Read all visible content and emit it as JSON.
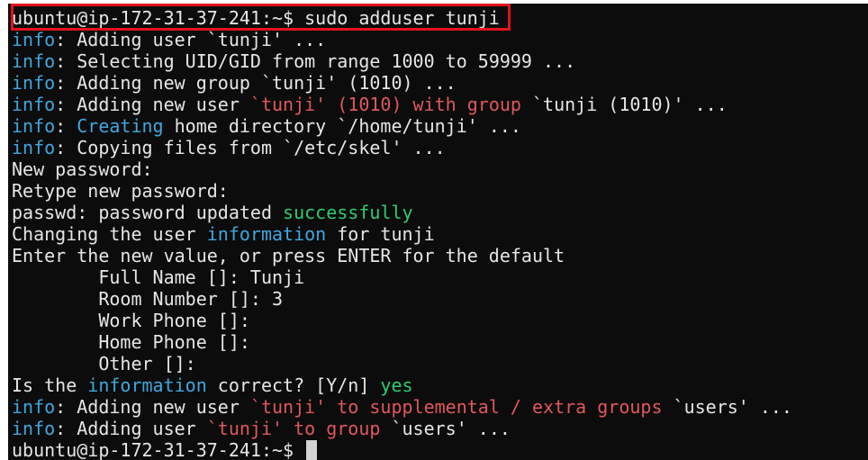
{
  "terminal": {
    "highlight_color": "#e3131b",
    "colors": {
      "default": "#e6e6e6",
      "info": "#3fa7df",
      "highlight_red": "#e0575d",
      "success_green": "#2ecc71",
      "background": "#0c0c0c"
    },
    "lines": [
      [
        {
          "t": "ubuntu@ip-172-31-37-241:~$ sudo adduser tunji",
          "c": ""
        }
      ],
      [
        {
          "t": "info",
          "c": "cyan"
        },
        {
          "t": ": Adding user `tunji' ...",
          "c": ""
        }
      ],
      [
        {
          "t": "info",
          "c": "cyan"
        },
        {
          "t": ": Selecting UID/GID from range 1000 to 59999 ...",
          "c": ""
        }
      ],
      [
        {
          "t": "info",
          "c": "cyan"
        },
        {
          "t": ": Adding new group `tunji' (1010) ...",
          "c": ""
        }
      ],
      [
        {
          "t": "info",
          "c": "cyan"
        },
        {
          "t": ": Adding new user ",
          "c": ""
        },
        {
          "t": "`tunji' (1010) with group",
          "c": "red"
        },
        {
          "t": " `tunji (1010)' ...",
          "c": ""
        }
      ],
      [
        {
          "t": "info",
          "c": "cyan"
        },
        {
          "t": ": ",
          "c": ""
        },
        {
          "t": "Creating",
          "c": "cyan"
        },
        {
          "t": " home directory `/home/tunji' ...",
          "c": ""
        }
      ],
      [
        {
          "t": "info",
          "c": "cyan"
        },
        {
          "t": ": Copying files from `/etc/skel' ...",
          "c": ""
        }
      ],
      [
        {
          "t": "New password:",
          "c": ""
        }
      ],
      [
        {
          "t": "Retype new password:",
          "c": ""
        }
      ],
      [
        {
          "t": "passwd: password updated ",
          "c": ""
        },
        {
          "t": "successfully",
          "c": "green"
        }
      ],
      [
        {
          "t": "Changing the user ",
          "c": ""
        },
        {
          "t": "information",
          "c": "cyan"
        },
        {
          "t": " for tunji",
          "c": ""
        }
      ],
      [
        {
          "t": "Enter the new value, or press ENTER for the default",
          "c": ""
        }
      ],
      [
        {
          "t": "        Full Name []: Tunji",
          "c": ""
        }
      ],
      [
        {
          "t": "        Room Number []: 3",
          "c": ""
        }
      ],
      [
        {
          "t": "        Work Phone []:",
          "c": ""
        }
      ],
      [
        {
          "t": "        Home Phone []:",
          "c": ""
        }
      ],
      [
        {
          "t": "        Other []:",
          "c": ""
        }
      ],
      [
        {
          "t": "Is the ",
          "c": ""
        },
        {
          "t": "information",
          "c": "cyan"
        },
        {
          "t": " correct? [Y/n] ",
          "c": ""
        },
        {
          "t": "yes",
          "c": "green"
        }
      ],
      [
        {
          "t": "info",
          "c": "cyan"
        },
        {
          "t": ": Adding new user ",
          "c": ""
        },
        {
          "t": "`tunji' to supplemental / extra groups",
          "c": "red"
        },
        {
          "t": " `users' ...",
          "c": ""
        }
      ],
      [
        {
          "t": "info",
          "c": "cyan"
        },
        {
          "t": ": Adding user ",
          "c": ""
        },
        {
          "t": "`tunji' to group",
          "c": "red"
        },
        {
          "t": " `users' ...",
          "c": ""
        }
      ],
      [
        {
          "t": "ubuntu@ip-172-31-37-241:~$ ",
          "c": ""
        }
      ]
    ]
  }
}
